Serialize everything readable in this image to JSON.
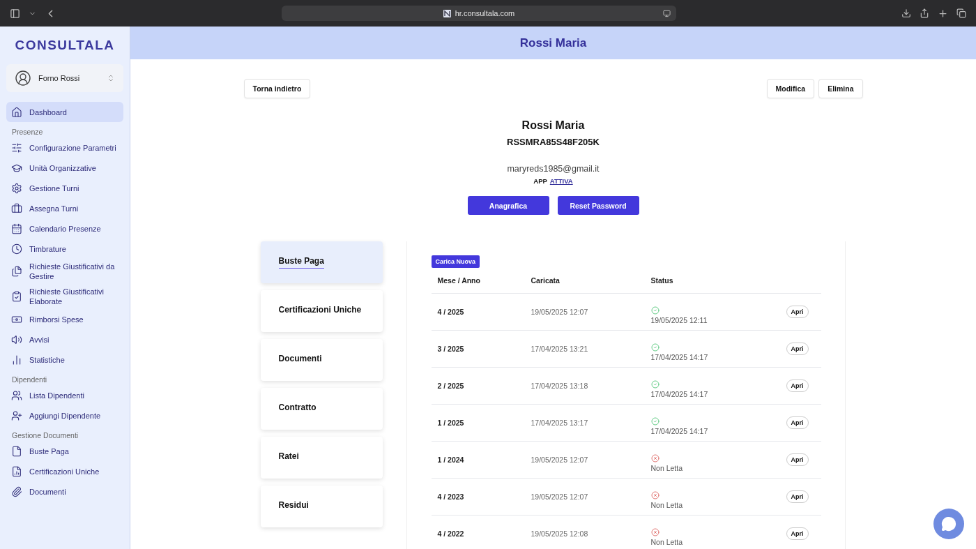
{
  "browser": {
    "url": "hr.consultala.com"
  },
  "sidebar": {
    "logo": "CONSULTALA",
    "account": {
      "name": "Forno Rossi"
    },
    "items": [
      {
        "label": "Dashboard",
        "selected": true
      }
    ],
    "sections": [
      {
        "title": "Presenze",
        "items": [
          {
            "label": "Configurazione Parametri",
            "selected": false
          },
          {
            "label": "Unità Organizzative",
            "selected": false
          },
          {
            "label": "Gestione Turni",
            "selected": false
          },
          {
            "label": "Assegna Turni",
            "selected": false
          },
          {
            "label": "Calendario Presenze",
            "selected": false
          },
          {
            "label": "Timbrature",
            "selected": false
          },
          {
            "label": "Richieste Giustificativi da Gestire",
            "selected": false
          },
          {
            "label": "Richieste Giustificativi Elaborate",
            "selected": false
          },
          {
            "label": "Rimborsi Spese",
            "selected": false
          },
          {
            "label": "Avvisi",
            "selected": false
          },
          {
            "label": "Statistiche",
            "selected": false
          }
        ]
      },
      {
        "title": "Dipendenti",
        "items": [
          {
            "label": "Lista Dipendenti",
            "selected": false
          },
          {
            "label": "Aggiungi Dipendente",
            "selected": false
          }
        ]
      },
      {
        "title": "Gestione Documenti",
        "items": [
          {
            "label": "Buste Paga",
            "selected": false
          },
          {
            "label": "Certificazioni Uniche",
            "selected": false
          },
          {
            "label": "Documenti",
            "selected": false
          }
        ]
      }
    ]
  },
  "header": {
    "title": "Rossi Maria"
  },
  "actions": {
    "back": "Torna indietro",
    "buttons": [
      "Modifica",
      "Elimina"
    ]
  },
  "profile": {
    "name": "Rossi Maria",
    "fiscal_code": "RSSMRA85S48F205K",
    "email": "maryreds1985@gmail.it",
    "app_label": "APP",
    "app_status": "ATTIVA",
    "buttons": [
      "Anagrafica",
      "Reset Password"
    ]
  },
  "tabs": [
    {
      "label": "Buste Paga",
      "selected": true
    },
    {
      "label": "Certificazioni Uniche",
      "selected": false
    },
    {
      "label": "Documenti",
      "selected": false
    },
    {
      "label": "Contratto",
      "selected": false
    },
    {
      "label": "Ratei",
      "selected": false
    },
    {
      "label": "Residui",
      "selected": false
    }
  ],
  "table": {
    "upload_button": "Carica Nuova",
    "columns": [
      "Mese / Anno",
      "Caricata",
      "Status"
    ],
    "rows": [
      {
        "period": "4 / 2025",
        "uploaded": "19/05/2025 12:07",
        "kind": "read",
        "status_text": "19/05/2025 12:11",
        "action": "Apri"
      },
      {
        "period": "3 / 2025",
        "uploaded": "17/04/2025 13:21",
        "kind": "read",
        "status_text": "17/04/2025 14:17",
        "action": "Apri"
      },
      {
        "period": "2 / 2025",
        "uploaded": "17/04/2025 13:18",
        "kind": "read",
        "status_text": "17/04/2025 14:17",
        "action": "Apri"
      },
      {
        "period": "1 / 2025",
        "uploaded": "17/04/2025 13:17",
        "kind": "read",
        "status_text": "17/04/2025 14:17",
        "action": "Apri"
      },
      {
        "period": "1 / 2024",
        "uploaded": "19/05/2025 12:07",
        "kind": "unread",
        "status_text": "Non Letta",
        "action": "Apri"
      },
      {
        "period": "4 / 2023",
        "uploaded": "19/05/2025 12:07",
        "kind": "unread",
        "status_text": "Non Letta",
        "action": "Apri"
      },
      {
        "period": "4 / 2022",
        "uploaded": "19/05/2025 12:08",
        "kind": "unread",
        "status_text": "Non Letta",
        "action": "Apri"
      }
    ]
  }
}
